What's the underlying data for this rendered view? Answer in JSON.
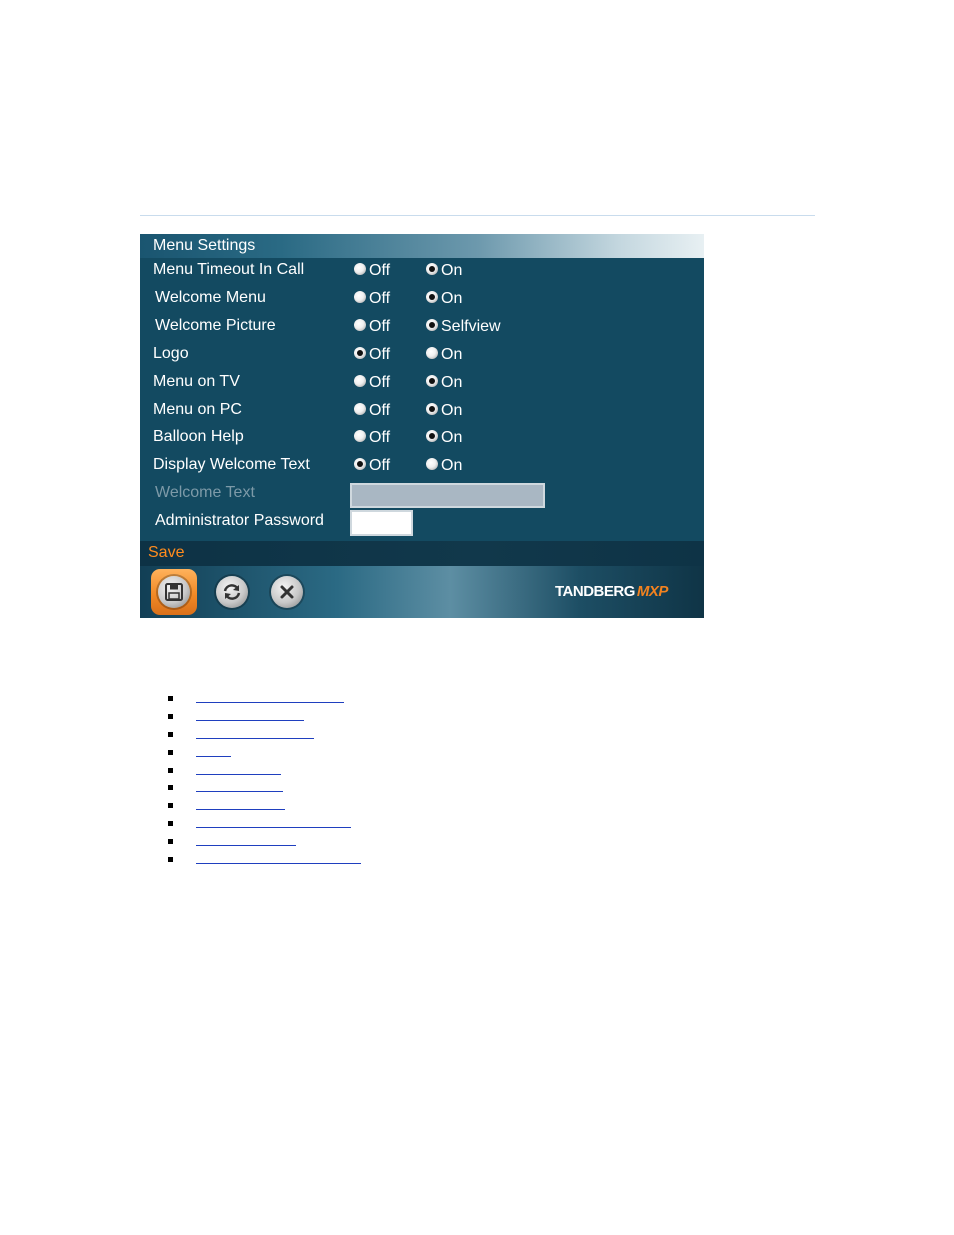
{
  "panel": {
    "title": "Menu Settings",
    "rows": [
      {
        "label": "Menu Timeout In Call",
        "off": "Off",
        "on": "On",
        "selected": "on"
      },
      {
        "label": "Welcome Menu",
        "off": "Off",
        "on": "On",
        "selected": "on"
      },
      {
        "label": "Welcome Picture",
        "off": "Off",
        "on": "Selfview",
        "selected": "on"
      },
      {
        "label": "Logo",
        "off": "Off",
        "on": "On",
        "selected": "off"
      },
      {
        "label": "Menu on TV",
        "off": "Off",
        "on": "On",
        "selected": "on"
      },
      {
        "label": "Menu on PC",
        "off": "Off",
        "on": "On",
        "selected": "on"
      },
      {
        "label": "Balloon Help",
        "off": "Off",
        "on": "On",
        "selected": "on"
      },
      {
        "label": "Display Welcome Text",
        "off": "Off",
        "on": "On",
        "selected": "off"
      }
    ],
    "welcome_text": {
      "label": "Welcome Text",
      "value": ""
    },
    "admin_password": {
      "label": "Administrator Password",
      "value": ""
    },
    "save_label": "Save",
    "toolbar": {
      "save_icon": "floppy-disk-icon",
      "refresh_icon": "refresh-icon",
      "cancel_icon": "close-icon"
    },
    "brand": {
      "name": "TANDBERG",
      "suffix": "MXP"
    }
  },
  "links": {
    "count": 10,
    "colors": {
      "link": "#1f3fbf"
    }
  }
}
